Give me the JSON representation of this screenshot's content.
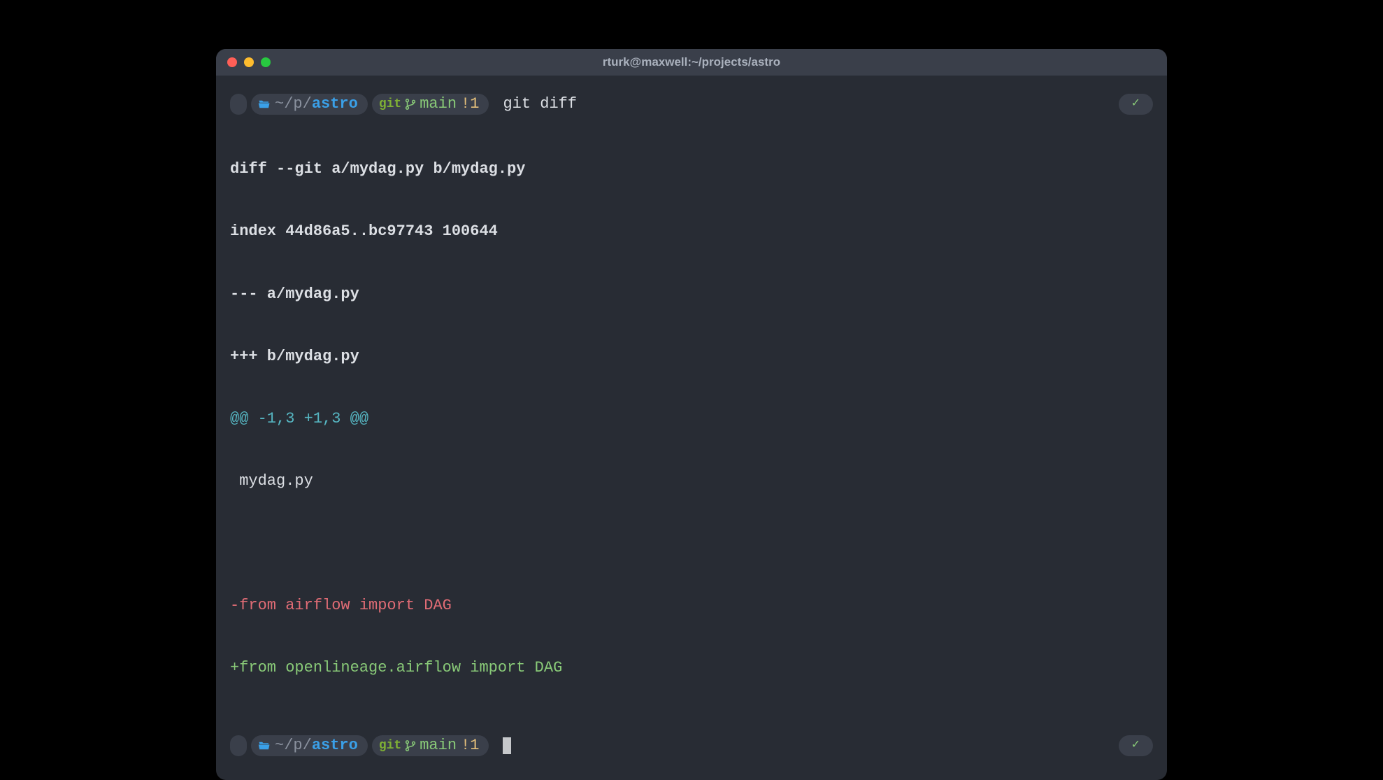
{
  "window": {
    "title": "rturk@maxwell:~/projects/astro"
  },
  "prompt1": {
    "path_prefix": "~/p/",
    "path_dir": "astro",
    "git_label": "git",
    "branch": "main",
    "dirty": "!1",
    "command": "git diff",
    "status_ok": "✓"
  },
  "diff": {
    "header1": "diff --git a/mydag.py b/mydag.py",
    "header2": "index 44d86a5..bc97743 100644",
    "header3": "--- a/mydag.py",
    "header4": "+++ b/mydag.py",
    "hunk": "@@ -1,3 +1,3 @@",
    "context1": " mydag.py",
    "removed": "-from airflow import DAG",
    "added": "+from openlineage.airflow import DAG"
  },
  "prompt2": {
    "path_prefix": "~/p/",
    "path_dir": "astro",
    "git_label": "git",
    "branch": "main",
    "dirty": "!1",
    "status_ok": "✓"
  },
  "colors": {
    "bg": "#282c34",
    "titlebar": "#3a3f4a",
    "green": "#89ca78",
    "red": "#e06c75",
    "cyan": "#56b6c2",
    "yellow": "#e5c07b",
    "blue": "#3aa0e8"
  }
}
